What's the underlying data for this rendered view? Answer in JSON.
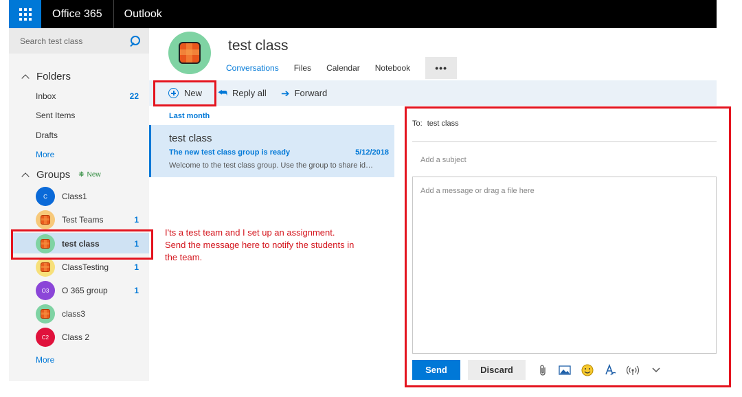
{
  "topbar": {
    "brand": "Office 365",
    "app": "Outlook"
  },
  "search": {
    "placeholder": "Search test class"
  },
  "folders": {
    "heading": "Folders",
    "items": [
      {
        "label": "Inbox",
        "count": "22"
      },
      {
        "label": "Sent Items",
        "count": ""
      },
      {
        "label": "Drafts",
        "count": ""
      }
    ],
    "more": "More"
  },
  "groups": {
    "heading": "Groups",
    "new_badge": "New",
    "items": [
      {
        "label": "Class1",
        "initials": "C",
        "count": "",
        "color": "#0b6ad8"
      },
      {
        "label": "Test Teams",
        "initials": "",
        "count": "1",
        "color": "#f7c97a"
      },
      {
        "label": "test class",
        "initials": "",
        "count": "1",
        "color": "#7fd3a3"
      },
      {
        "label": "ClassTesting",
        "initials": "",
        "count": "1",
        "color": "#f7e07a"
      },
      {
        "label": "O 365 group",
        "initials": "O3",
        "count": "1",
        "color": "#8b46d8"
      },
      {
        "label": "class3",
        "initials": "",
        "count": "",
        "color": "#7fd3a3"
      },
      {
        "label": "Class 2",
        "initials": "C2",
        "count": "",
        "color": "#e0123c"
      }
    ],
    "more": "More"
  },
  "group_header": {
    "title": "test class",
    "tabs": [
      "Conversations",
      "Files",
      "Calendar",
      "Notebook"
    ],
    "more_tab": "•••"
  },
  "commands": {
    "new": "New",
    "reply_all": "Reply all",
    "forward": "Forward"
  },
  "message_list": {
    "section": "Last month",
    "messages": [
      {
        "from": "test class",
        "subject": "The new test class group is ready",
        "date": "5/12/2018",
        "preview": "Welcome to the test class group. Use the group to share ideas, files, and important dates."
      }
    ]
  },
  "annotation": "I'ts a test team and I set up an assignment. Send the message here to notify the students in the team.",
  "compose": {
    "to_label": "To:",
    "to_value": "test class",
    "subject_placeholder": "Add a subject",
    "body_placeholder": "Add a message or drag a file here",
    "send": "Send",
    "discard": "Discard"
  },
  "colors": {
    "accent": "#0078d7",
    "highlight": "#e4141f",
    "selected": "#cfe2f3"
  }
}
